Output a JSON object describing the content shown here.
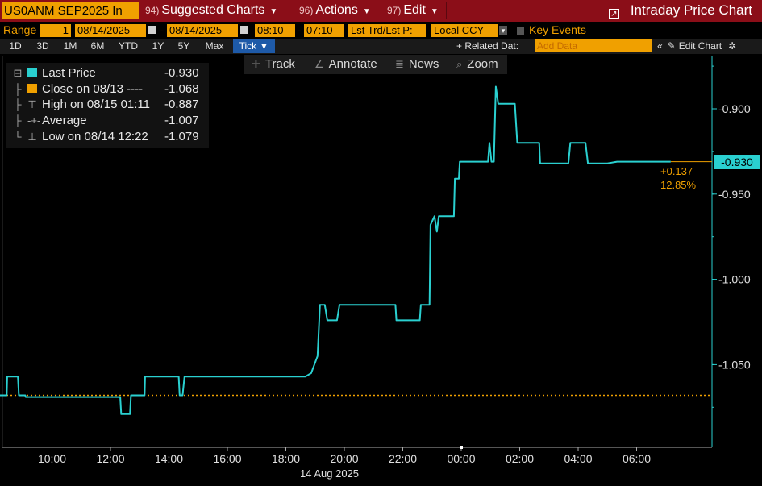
{
  "titlebar": {
    "security": "US0ANM SEP2025 In",
    "menus": [
      {
        "num": "94)",
        "label": "Suggested Charts"
      },
      {
        "num": "96)",
        "label": "Actions"
      },
      {
        "num": "97)",
        "label": "Edit"
      }
    ],
    "right_title": "Intraday Price Chart"
  },
  "rangebar": {
    "range_label": "Range",
    "range_value": "1",
    "start_date": "08/14/2025",
    "end_date": "08/14/2025",
    "start_time": "08:10",
    "end_time": "07:10",
    "price_field": "Lst Trd/Lst P:",
    "currency": "Local CCY",
    "key_events": "Key Events"
  },
  "periodbar": {
    "periods": [
      "1D",
      "3D",
      "1M",
      "6M",
      "YTD",
      "1Y",
      "5Y",
      "Max"
    ],
    "tick_label": "Tick",
    "related": "+ Related Dat:",
    "add_data_placeholder": "Add Data",
    "edit_chart": "Edit Chart"
  },
  "toolbar": {
    "items": [
      {
        "icon": "crosshair-icon",
        "label": "Track"
      },
      {
        "icon": "pencil-icon",
        "label": "Annotate"
      },
      {
        "icon": "news-icon",
        "label": "News"
      },
      {
        "icon": "zoom-icon",
        "label": "Zoom"
      }
    ]
  },
  "legend": {
    "rows": [
      {
        "label": "Last Price",
        "value": "-0.930"
      },
      {
        "label": "Close on 08/13 ----",
        "value": "-1.068"
      },
      {
        "label": "High on 08/15 01:11",
        "value": "-0.887"
      },
      {
        "label": "Average",
        "value": "-1.007"
      },
      {
        "label": "Low on 08/14 12:22",
        "value": "-1.079"
      }
    ]
  },
  "colors": {
    "line": "#2ad0d0",
    "close": "#f0a000",
    "title_bar": "#8b0e18",
    "accent": "#f0a000"
  },
  "chart_data": {
    "type": "line",
    "title": "Intraday Price Chart",
    "date_label": "14 Aug 2025",
    "x_ticks": [
      "10:00",
      "12:00",
      "14:00",
      "16:00",
      "18:00",
      "20:00",
      "22:00",
      "00:00",
      "02:00",
      "04:00",
      "06:00"
    ],
    "y_ticks": [
      "-0.900",
      "-0.950",
      "-1.000",
      "-1.050"
    ],
    "ylim": [
      -1.095,
      -0.867
    ],
    "last_price": "-0.930",
    "change": "+0.137",
    "change_pct": "12.85%",
    "close_prev": -1.068,
    "series": [
      {
        "name": "Last Price",
        "points": [
          [
            "08:10",
            -1.068
          ],
          [
            "08:27",
            -1.068
          ],
          [
            "08:28",
            -1.057
          ],
          [
            "08:50",
            -1.057
          ],
          [
            "08:52",
            -1.068
          ],
          [
            "09:05",
            -1.068
          ],
          [
            "09:06",
            -1.069
          ],
          [
            "12:20",
            -1.069
          ],
          [
            "12:22",
            -1.079
          ],
          [
            "12:40",
            -1.079
          ],
          [
            "12:42",
            -1.068
          ],
          [
            "13:10",
            -1.068
          ],
          [
            "13:11",
            -1.057
          ],
          [
            "14:20",
            -1.057
          ],
          [
            "14:22",
            -1.068
          ],
          [
            "14:28",
            -1.068
          ],
          [
            "14:32",
            -1.057
          ],
          [
            "17:30",
            -1.057
          ],
          [
            "18:40",
            -1.057
          ],
          [
            "18:52",
            -1.055
          ],
          [
            "19:05",
            -1.045
          ],
          [
            "19:10",
            -1.015
          ],
          [
            "19:20",
            -1.015
          ],
          [
            "19:25",
            -1.024
          ],
          [
            "19:45",
            -1.024
          ],
          [
            "19:50",
            -1.015
          ],
          [
            "21:45",
            -1.015
          ],
          [
            "21:47",
            -1.024
          ],
          [
            "22:35",
            -1.024
          ],
          [
            "22:37",
            -1.015
          ],
          [
            "22:55",
            -1.015
          ],
          [
            "22:57",
            -0.968
          ],
          [
            "23:05",
            -0.963
          ],
          [
            "23:10",
            -0.972
          ],
          [
            "23:14",
            -0.963
          ],
          [
            "23:45",
            -0.963
          ],
          [
            "23:47",
            -0.941
          ],
          [
            "23:55",
            -0.941
          ],
          [
            "23:57",
            -0.931
          ],
          [
            "00:55",
            -0.931
          ],
          [
            "00:58",
            -0.92
          ],
          [
            "01:02",
            -0.931
          ],
          [
            "01:07",
            -0.931
          ],
          [
            "01:11",
            -0.887
          ],
          [
            "01:16",
            -0.897
          ],
          [
            "01:50",
            -0.897
          ],
          [
            "01:55",
            -0.92
          ],
          [
            "02:40",
            -0.92
          ],
          [
            "02:42",
            -0.932
          ],
          [
            "03:40",
            -0.932
          ],
          [
            "03:44",
            -0.92
          ],
          [
            "04:15",
            -0.92
          ],
          [
            "04:20",
            -0.932
          ],
          [
            "05:00",
            -0.932
          ],
          [
            "05:20",
            -0.931
          ],
          [
            "07:10",
            -0.931
          ]
        ]
      }
    ]
  }
}
